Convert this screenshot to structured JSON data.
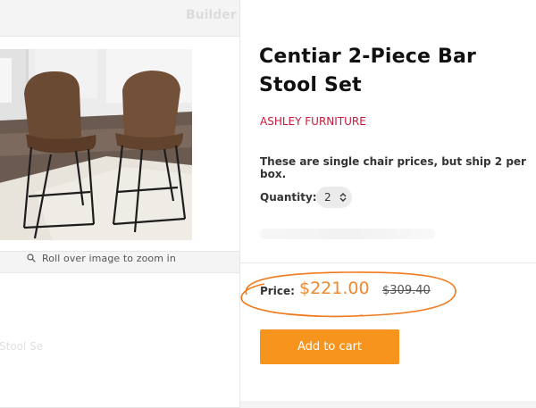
{
  "header": {
    "breadcrumb_tail": "Builder"
  },
  "gallery": {
    "zoom_hint": "Roll over image to zoom in",
    "icon": "search-icon"
  },
  "secondary": {
    "faded_label": "Stool Se"
  },
  "product": {
    "title": "Centiar 2-Piece Bar Stool Set",
    "brand": "ASHLEY FURNITURE",
    "note": "These are single chair prices, but ship 2 per box.",
    "quantity": {
      "label": "Quantity:",
      "value": "2",
      "icon": "chevron-up-down-icon"
    },
    "price": {
      "label": "Price:",
      "current": "$221.00",
      "original": "$309.40"
    },
    "add_to_cart_label": "Add to cart"
  },
  "colors": {
    "accent": "#f7941d",
    "price": "#f0882b",
    "brand": "#c51a3a",
    "annotation": "#f07a1e"
  }
}
